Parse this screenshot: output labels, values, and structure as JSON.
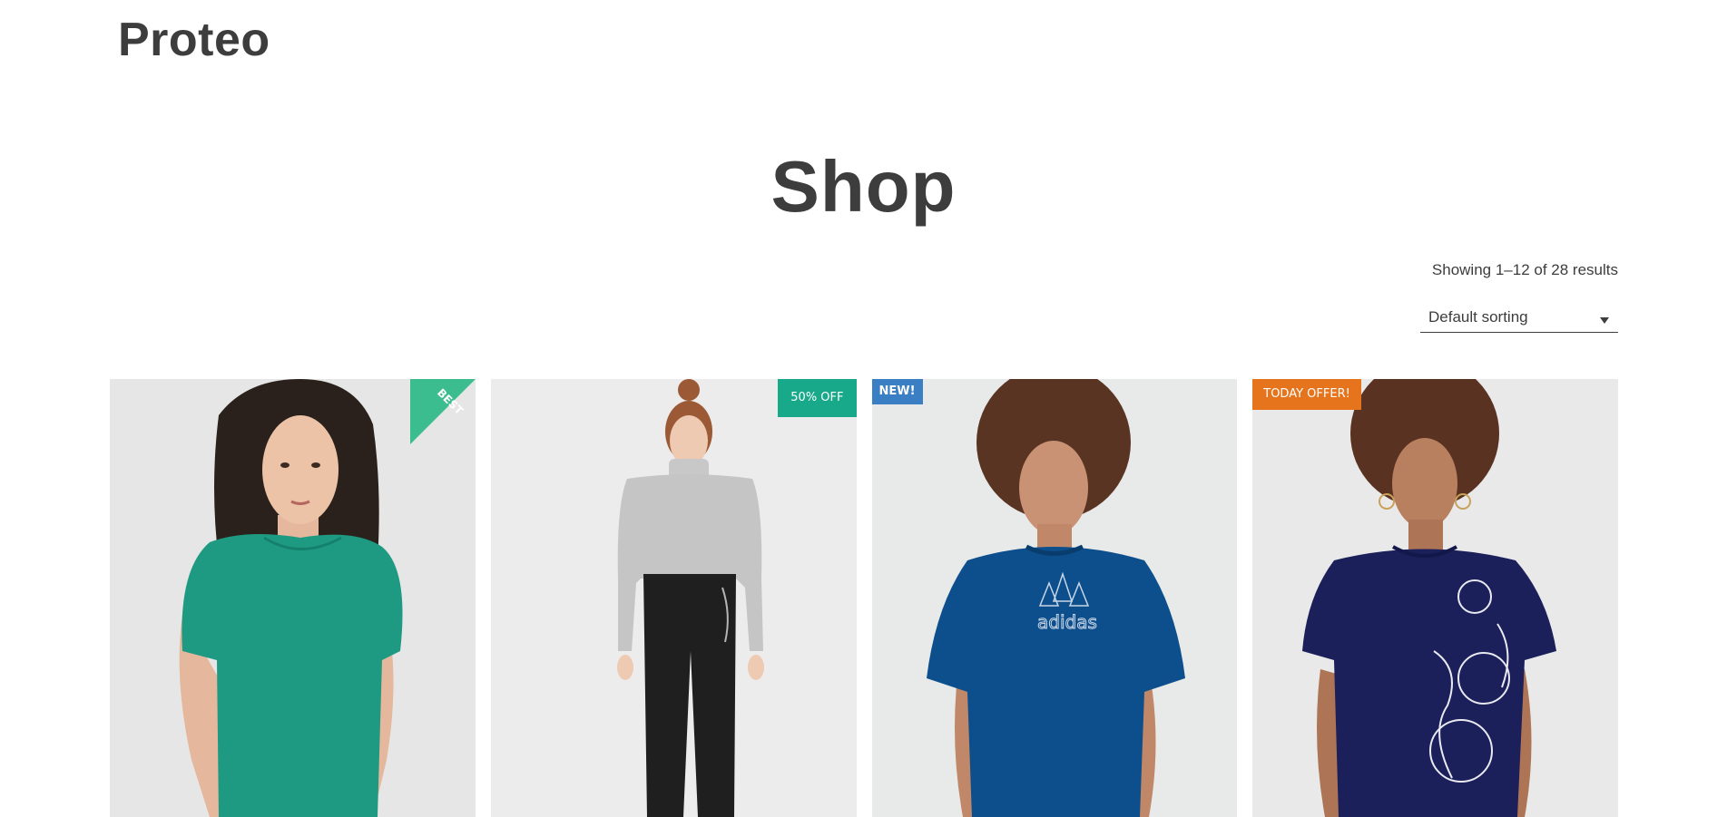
{
  "site": {
    "logo": "Proteo"
  },
  "page": {
    "title": "Shop"
  },
  "toolbar": {
    "result_count": "Showing 1–12 of 28 results",
    "sorting": {
      "selected": "Default sorting"
    }
  },
  "products": [
    {
      "badge": "BEST",
      "badge_style": "corner-ribbon",
      "badge_color": "#3cbd8f",
      "image": "woman in green short-sleeve knit top"
    },
    {
      "badge": "50% OFF",
      "badge_style": "top-right",
      "badge_color": "#17a98a",
      "image": "woman in grey turtleneck sweater and black cargo trousers"
    },
    {
      "badge": "NEW!",
      "badge_style": "top-left",
      "badge_color": "#3a7fc4",
      "image": "man in blue adidas t-shirt"
    },
    {
      "badge": "TODAY OFFER!",
      "badge_style": "top-left",
      "badge_color": "#e6741c",
      "image": "woman in navy floral print t-shirt"
    }
  ],
  "colors": {
    "text": "#3d3d3d",
    "photo_background": "#e8e8e8"
  }
}
